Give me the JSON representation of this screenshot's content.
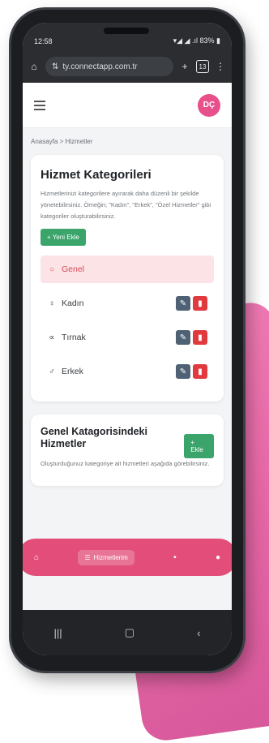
{
  "status": {
    "time": "12:58",
    "right": "▾◢ ◢ .ıl 83% ▮"
  },
  "browser": {
    "url": "ty.connectapp.com.tr",
    "tabs_count": "13"
  },
  "header": {
    "avatar_initials": "DÇ"
  },
  "breadcrumb": "Anasayfa > Hizmetler",
  "categories_card": {
    "title": "Hizmet Kategorileri",
    "description": "Hizmetlerinizi kategorilere ayırarak daha düzenli bir şekilde yönetebilirsiniz. Örneğin; \"Kadın\", \"Erkek\", \"Özel Hizmetler\" gibi kategoriler oluşturabilirsiniz.",
    "add_label": "+ Yeni Ekle",
    "items": [
      {
        "label": "Genel",
        "icon": "○"
      },
      {
        "label": "Kadın",
        "icon": "♀"
      },
      {
        "label": "Tırnak",
        "icon": "∝"
      },
      {
        "label": "Erkek",
        "icon": "♂"
      }
    ]
  },
  "services_card": {
    "title": "Genel Katagorisindeki Hizmetler",
    "description": "Oluşturduğunuz kategoriye ait hizmetleri aşağıda görebilirsiniz.",
    "add_label": "+ Ekle"
  },
  "bottom_nav": {
    "active_label": "Hizmetlerim"
  },
  "colors": {
    "accent": "#e24d79",
    "green": "#3aa46b",
    "danger": "#e03a3f",
    "edit": "#4f6175"
  }
}
